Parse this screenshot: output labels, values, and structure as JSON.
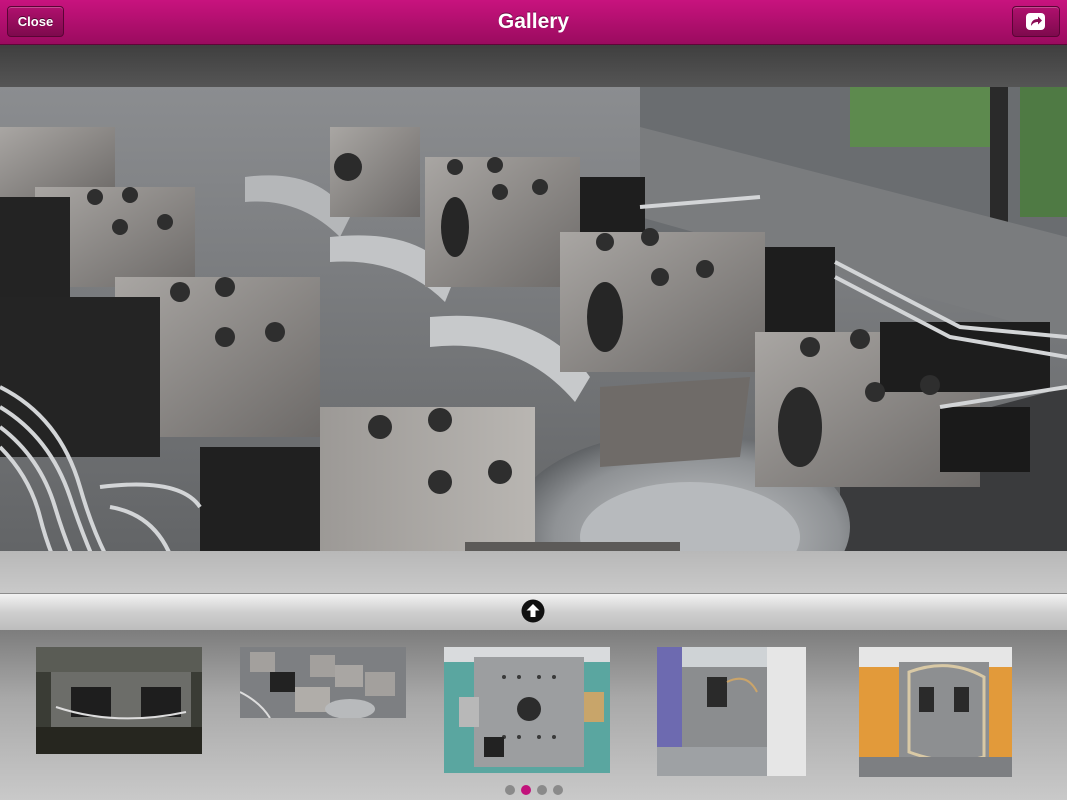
{
  "header": {
    "title": "Gallery",
    "close_label": "Close",
    "share_icon": "share-arrow-icon",
    "accent_color": "#b0106e"
  },
  "viewer": {
    "main_image": "mould-plate-with-hydraulic-blocks"
  },
  "toggle": {
    "icon": "arrow-up-circle-icon"
  },
  "thumbnails": [
    {
      "name": "mould-on-press"
    },
    {
      "name": "mould-plate-hydraulic-blocks"
    },
    {
      "name": "mould-blue-press-front"
    },
    {
      "name": "mould-blue-press-side"
    },
    {
      "name": "mould-orange-press"
    }
  ],
  "pagination": {
    "pages": 4,
    "current": 2
  }
}
